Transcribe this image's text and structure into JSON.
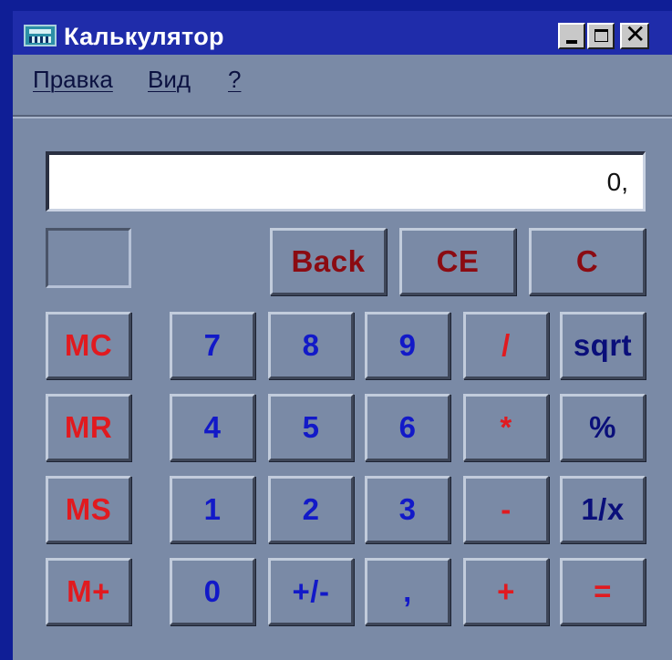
{
  "window": {
    "title": "Калькулятор",
    "colors": {
      "titlebar": "#1f2caa",
      "face": "#7a8aa6",
      "display_bg": "#ffffff"
    }
  },
  "title_buttons": {
    "minimize": "_",
    "close": "✕"
  },
  "menu": {
    "items": [
      "Правка",
      "Вид",
      "?"
    ]
  },
  "display": {
    "value": "0,"
  },
  "buttons": {
    "back": "Back",
    "ce": "CE",
    "c": "C",
    "mc": "MC",
    "mr": "MR",
    "ms": "MS",
    "mplus": "M+",
    "n7": "7",
    "n8": "8",
    "n9": "9",
    "div": "/",
    "sqrt": "sqrt",
    "n4": "4",
    "n5": "5",
    "n6": "6",
    "mul": "*",
    "pct": "%",
    "n1": "1",
    "n2": "2",
    "n3": "3",
    "sub": "-",
    "recip": "1/x",
    "n0": "0",
    "sign": "+/-",
    "comma": ",",
    "add": "+",
    "eq": "="
  },
  "icons": {
    "app": "calculator-icon",
    "minimize": "minimize-icon",
    "maximize": "maximize-icon",
    "close": "close-icon"
  }
}
